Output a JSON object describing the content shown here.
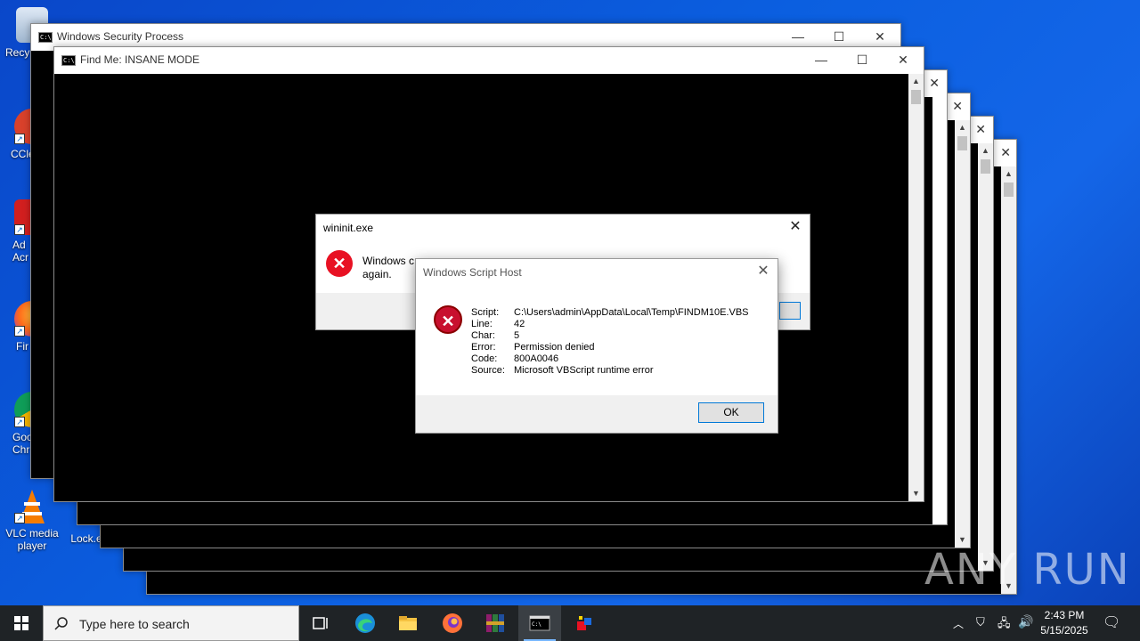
{
  "desktop_icons": [
    {
      "label": "Recy",
      "icon": "recycle-bin-icon"
    },
    {
      "label": "CCle",
      "icon": "ccleaner-icon"
    },
    {
      "label": "Ad Acr",
      "icon": "adobe-acrobat-icon"
    },
    {
      "label": "Fir",
      "icon": "firefox-icon"
    },
    {
      "label": "Goo Chr",
      "icon": "chrome-icon"
    },
    {
      "label": "VLC media player",
      "icon": "vlc-icon"
    },
    {
      "label": "Lock.e",
      "icon": "file-icon"
    }
  ],
  "windows": {
    "security_process": {
      "title": "Windows Security Process"
    },
    "find_me": {
      "title": "Find Me: INSANE MODE"
    }
  },
  "wininit_dialog": {
    "title": "wininit.exe",
    "message_line1": "Windows c",
    "message_line1_tail": "again."
  },
  "wsh_dialog": {
    "title": "Windows Script Host",
    "fields": [
      {
        "key": "Script:",
        "value": "C:\\Users\\admin\\AppData\\Local\\Temp\\FINDM10E.VBS"
      },
      {
        "key": "Line:",
        "value": "42"
      },
      {
        "key": "Char:",
        "value": "5"
      },
      {
        "key": "Error:",
        "value": "Permission denied"
      },
      {
        "key": "Code:",
        "value": "800A0046"
      },
      {
        "key": "Source:",
        "value": "Microsoft VBScript runtime error"
      }
    ],
    "ok_label": "OK"
  },
  "taskbar": {
    "search_placeholder": "Type here to search",
    "apps": [
      "task-view-icon",
      "edge-icon",
      "file-explorer-icon",
      "firefox-icon",
      "winrar-icon",
      "cmd-icon",
      "app-icon"
    ],
    "clock_time": "2:43 PM",
    "clock_date": "5/15/2025"
  },
  "watermark": "ANY RUN",
  "colors": {
    "desktop": "#0b5fe0",
    "taskbar": "#1f2326",
    "error_red": "#e81123",
    "focus_blue": "#0078d7"
  }
}
